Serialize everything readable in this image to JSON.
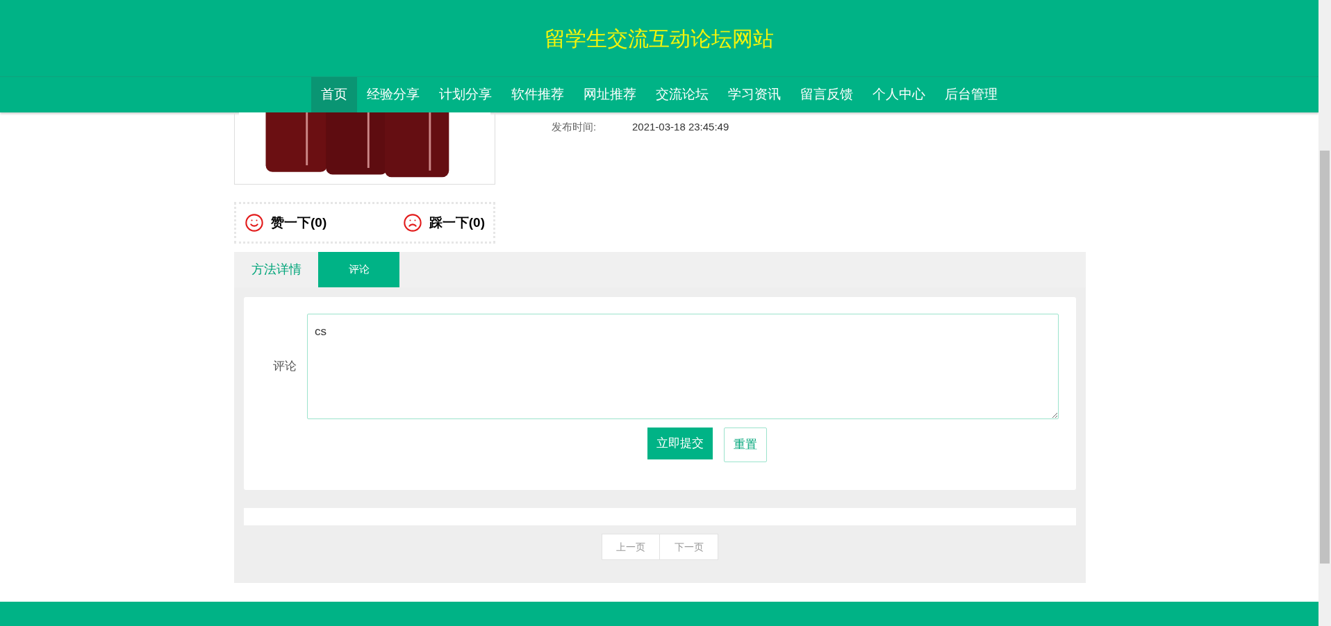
{
  "site_title": "留学生交流互动论坛网站",
  "nav": [
    {
      "label": "首页",
      "selected": true
    },
    {
      "label": "经验分享",
      "selected": false
    },
    {
      "label": "计划分享",
      "selected": false
    },
    {
      "label": "软件推荐",
      "selected": false
    },
    {
      "label": "网址推荐",
      "selected": false
    },
    {
      "label": "交流论坛",
      "selected": false
    },
    {
      "label": "学习资讯",
      "selected": false
    },
    {
      "label": "留言反馈",
      "selected": false
    },
    {
      "label": "个人中心",
      "selected": false
    },
    {
      "label": "后台管理",
      "selected": false
    }
  ],
  "post": {
    "fields": [
      {
        "label": "发布时间:",
        "value": "2021-03-18 23:45:49"
      }
    ]
  },
  "reactions": [
    {
      "kind": "like",
      "label": "赞一下(0)"
    },
    {
      "kind": "dislike",
      "label": "踩一下(0)"
    }
  ],
  "tabs": [
    {
      "label": "方法详情",
      "selected": false
    },
    {
      "label": "评论",
      "selected": true
    }
  ],
  "comment_form": {
    "label": "评论",
    "value": "cs",
    "buttons": [
      {
        "kind": "primary",
        "label": "立即提交"
      },
      {
        "kind": "secondary",
        "label": "重置"
      }
    ]
  },
  "pagination": [
    {
      "label": "上一页",
      "disabled": true
    },
    {
      "label": "下一页",
      "disabled": true
    }
  ]
}
